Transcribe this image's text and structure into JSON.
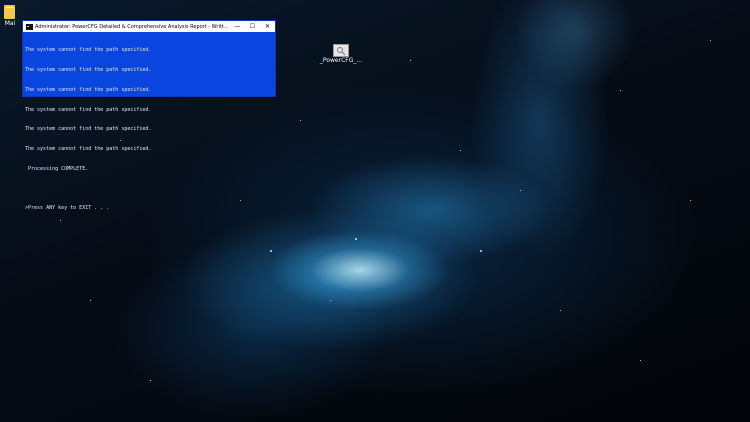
{
  "desktop": {
    "icons": [
      {
        "label": "Mai",
        "icon": "folder-icon"
      },
      {
        "label": "_PowerCFG_...",
        "icon": "script-icon"
      }
    ]
  },
  "console_window": {
    "title": "Administrator:  PowerCFG Detailed & Comprehensive Analysis Report - Written by Paul...",
    "buttons": {
      "minimize": "—",
      "maximize": "☐",
      "close": "✕"
    },
    "lines": [
      "The system cannot find the path specified.",
      "The system cannot find the path specified.",
      "The system cannot find the path specified.",
      "The system cannot find the path specified.",
      "The system cannot find the path specified.",
      "The system cannot find the path specified.",
      " Processing COMPLETE.",
      "",
      ">Press ANY key to EXIT . . ."
    ],
    "background_color": "#0a45e0",
    "text_color": "#dfe8ff"
  }
}
